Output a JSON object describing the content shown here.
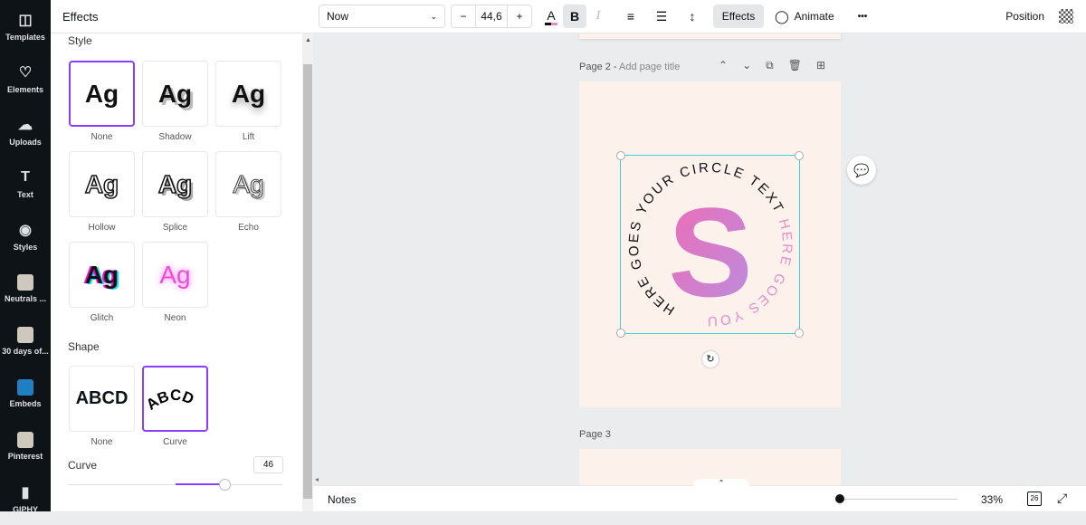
{
  "rail": [
    {
      "label": "Templates",
      "icon": "templates-icon"
    },
    {
      "label": "Elements",
      "icon": "elements-icon"
    },
    {
      "label": "Uploads",
      "icon": "uploads-icon"
    },
    {
      "label": "Text",
      "icon": "text-icon"
    },
    {
      "label": "Styles",
      "icon": "styles-icon"
    },
    {
      "label": "Neutrals ...",
      "icon": "folder-thumb"
    },
    {
      "label": "30 days of...",
      "icon": "folder-thumb"
    },
    {
      "label": "Embeds",
      "icon": "embeds-icon"
    },
    {
      "label": "Pinterest",
      "icon": "pinterest-thumb"
    },
    {
      "label": "GIPHY",
      "icon": "giphy-icon"
    }
  ],
  "panel": {
    "title": "Effects",
    "style_heading": "Style",
    "styles": [
      {
        "label": "None",
        "sample": "Ag"
      },
      {
        "label": "Shadow",
        "sample": "Ag"
      },
      {
        "label": "Lift",
        "sample": "Ag"
      },
      {
        "label": "Hollow",
        "sample": "Ag"
      },
      {
        "label": "Splice",
        "sample": "Ag"
      },
      {
        "label": "Echo",
        "sample": "Ag"
      },
      {
        "label": "Glitch",
        "sample": "Ag"
      },
      {
        "label": "Neon",
        "sample": "Ag"
      }
    ],
    "shape_heading": "Shape",
    "shapes": [
      {
        "label": "None",
        "sample": "ABCD"
      },
      {
        "label": "Curve",
        "sample": "ABCD"
      }
    ],
    "curve_label": "Curve",
    "curve_value": "46",
    "curve_range": [
      -100,
      100
    ]
  },
  "toolbar": {
    "font": "Now",
    "size": "44,6",
    "minus": "−",
    "plus": "+",
    "bold": "B",
    "italic": "I",
    "effects": "Effects",
    "animate": "Animate",
    "more": "•••",
    "position": "Position"
  },
  "canvas": {
    "page2_label": "Page 2 - ",
    "page2_title_placeholder": "Add page title",
    "page3_label": "Page 3",
    "circle_text_black": "HERE GOES YOUR CIRCLE TEXT ",
    "circle_text_pink": "HERE GOES YOUR CIRCLE",
    "letter": "S"
  },
  "bottom": {
    "notes": "Notes",
    "zoom": "33%",
    "zoom_fraction": 0.0,
    "page_count": "26"
  },
  "colors": {
    "accent": "#8b3dff",
    "selection": "#3ed1dc",
    "pink": "#e58dcb"
  }
}
